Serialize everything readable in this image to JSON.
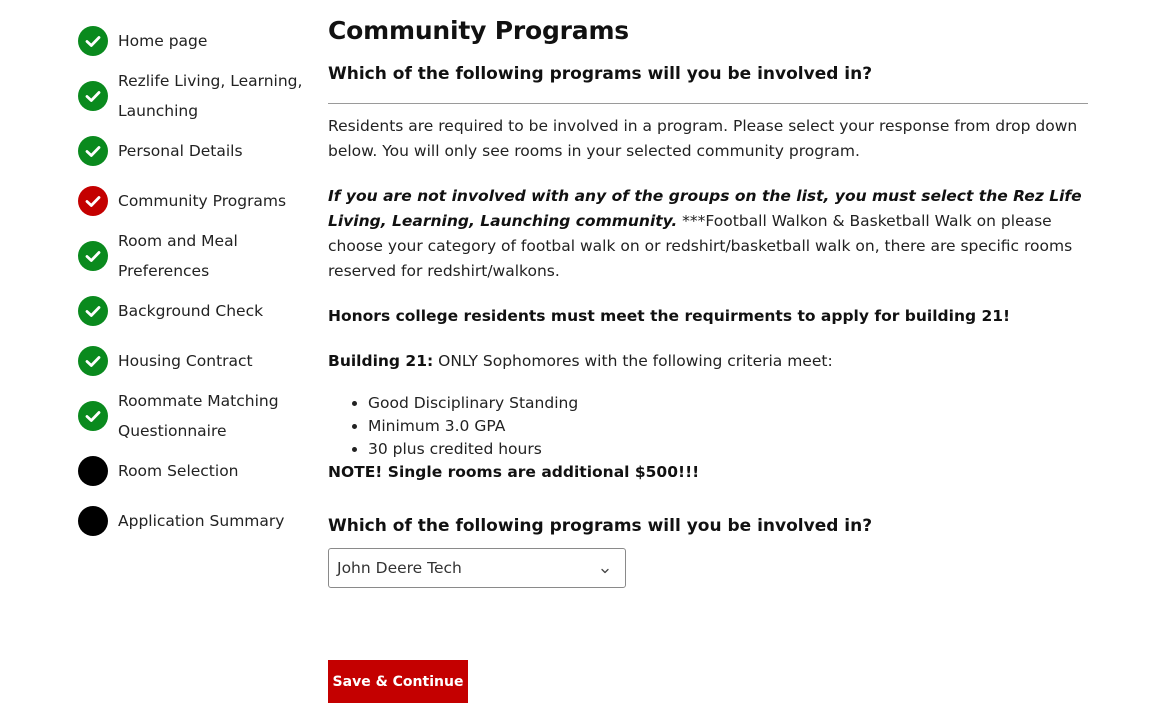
{
  "colors": {
    "complete": "#0a8a1e",
    "current": "#c40000",
    "pending": "#000000",
    "button": "#c40000"
  },
  "sidebar": {
    "steps": [
      {
        "label": "Home page",
        "status": "complete",
        "icon": "check-circle-icon"
      },
      {
        "label": "Rezlife Living, Learning, Launching",
        "status": "complete",
        "icon": "check-circle-icon"
      },
      {
        "label": "Personal Details",
        "status": "complete",
        "icon": "check-circle-icon"
      },
      {
        "label": "Community Programs",
        "status": "current",
        "icon": "check-circle-icon"
      },
      {
        "label": "Room and Meal Preferences",
        "status": "complete",
        "icon": "check-circle-icon"
      },
      {
        "label": "Background Check",
        "status": "complete",
        "icon": "check-circle-icon"
      },
      {
        "label": "Housing Contract",
        "status": "complete",
        "icon": "check-circle-icon"
      },
      {
        "label": "Roommate Matching Questionnaire",
        "status": "complete",
        "icon": "check-circle-icon"
      },
      {
        "label": "Room Selection",
        "status": "pending",
        "icon": "circle-icon"
      },
      {
        "label": "Application Summary",
        "status": "pending",
        "icon": "circle-icon"
      }
    ]
  },
  "main": {
    "title": "Community Programs",
    "question_heading": "Which of the following programs will you be involved in?",
    "intro": "Residents are required to be involved in a program. Please select your response from drop down below. You will only see rooms in your selected community program.",
    "notice_emphasis": "If you are not involved with any of the groups on the list, you must select the Rez Life Living, Learning, Launching community.",
    "notice_rest": " ***Football Walkon & Basketball Walk on please choose your category of footbal walk on or redshirt/basketball walk on, there are specific rooms reserved for redshirt/walkons.",
    "honors": "Honors college residents must meet the requirments to apply for building 21!",
    "building_label": "Building 21:",
    "building_text": " ONLY Sophomores with the following criteria meet:",
    "criteria": [
      "Good Disciplinary Standing",
      "Minimum 3.0 GPA",
      "30 plus credited hours"
    ],
    "note": "NOTE! Single rooms are additional $500!!!",
    "select_heading": "Which of the following programs will you be involved in?",
    "select_value": "John Deere Tech",
    "select_icon": "chevron-down-icon",
    "save_label": "Save & Continue"
  }
}
